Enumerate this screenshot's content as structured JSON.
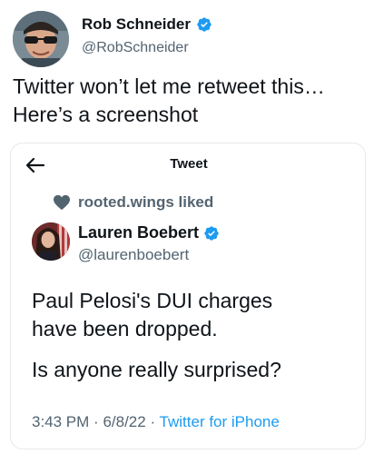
{
  "outer_tweet": {
    "author_name": "Rob Schneider",
    "author_handle": "@RobSchneider",
    "text_lines": [
      "Twitter won’t let me retweet this…",
      "Here’s a screenshot"
    ],
    "verified_icon": "verified-badge-icon"
  },
  "embedded": {
    "header_title": "Tweet",
    "back_icon": "back-arrow-icon",
    "liked_by": "rooted.wings liked",
    "liked_icon": "heart-icon",
    "author_name": "Lauren Boebert",
    "author_handle": "@laurenboebert",
    "paragraphs": [
      [
        "Paul Pelosi's DUI charges",
        "have been dropped."
      ],
      [
        "Is anyone really surprised?"
      ]
    ],
    "time": "3:43 PM",
    "date": "6/8/22",
    "separator": "·",
    "source": "Twitter for iPhone"
  },
  "colors": {
    "text_primary": "#0f1419",
    "text_secondary": "#536471",
    "accent_blue": "#1d9bf0",
    "border": "#e7e9ea"
  }
}
